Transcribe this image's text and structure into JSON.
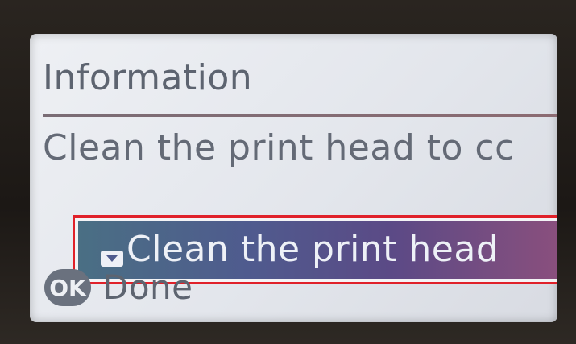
{
  "screen": {
    "title": "Information",
    "message": "Clean the print head to cc",
    "action_button": {
      "label": "Clean the print head",
      "icon": "down-arrow-icon"
    },
    "ok_hint": {
      "icon_text": "OK",
      "label": "Done"
    }
  },
  "colors": {
    "highlight_border": "#e0212a",
    "selection_gradient_start": "#4a6f84",
    "selection_gradient_end": "#8a4f7d",
    "lcd_text": "#5d6470"
  }
}
